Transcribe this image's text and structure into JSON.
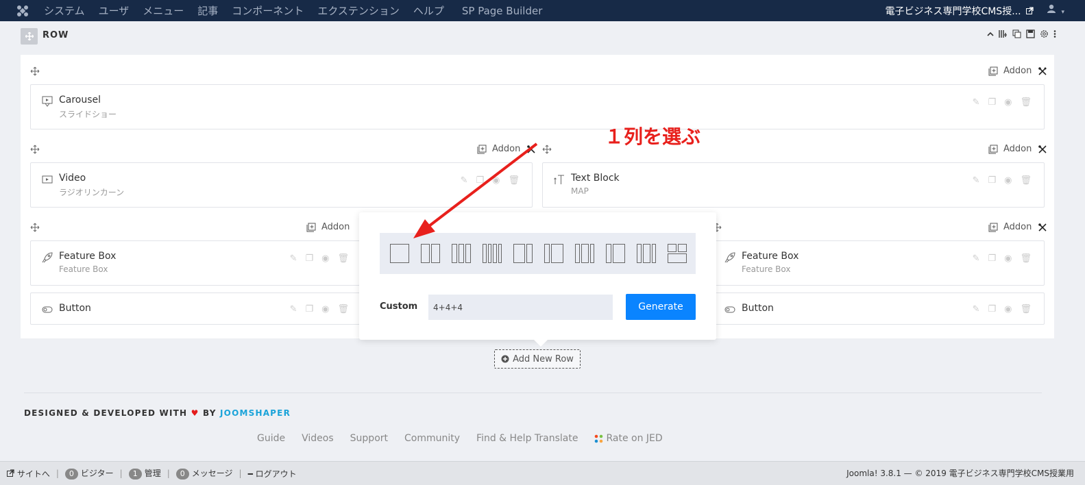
{
  "topbar": {
    "menu": [
      "システム",
      "ユーザ",
      "メニュー",
      "記事",
      "コンポーネント",
      "エクステンション",
      "ヘルプ"
    ],
    "page_builder": "SP Page Builder",
    "site_name": "電子ビジネス専門学校CMS授..."
  },
  "row": {
    "title": "ROW"
  },
  "addon_label": "Addon",
  "cards": {
    "carousel": {
      "title": "Carousel",
      "subtitle": "スライドショー"
    },
    "video": {
      "title": "Video",
      "subtitle": "ラジオリンカーン"
    },
    "text_block": {
      "title": "Text Block",
      "subtitle": "MAP"
    },
    "feature_box_left": {
      "title": "Feature Box",
      "subtitle": "Feature Box"
    },
    "button_left": {
      "title": "Button"
    },
    "feature_box_right": {
      "title": "Feature Box",
      "subtitle": "Feature Box"
    },
    "button_right": {
      "title": "Button"
    }
  },
  "popover": {
    "custom_label": "Custom",
    "custom_value": "4+4+4",
    "generate_label": "Generate"
  },
  "add_row_label": "Add New Row",
  "annotation": "１列を選ぶ",
  "footer": {
    "credit_prefix": "DESIGNED & DEVELOPED WITH",
    "credit_by": "BY",
    "credit_brand": "JOOMSHAPER",
    "links": [
      "Guide",
      "Videos",
      "Support",
      "Community",
      "Find & Help Translate",
      "Rate on JED"
    ]
  },
  "status": {
    "site": "サイトへ",
    "visitors_count": "0",
    "visitors": "ビジター",
    "admin_count": "1",
    "admin": "管理",
    "messages_count": "0",
    "messages": "メッセージ",
    "logout": "ログアウト",
    "version": "Joomla! 3.8.1 — © 2019 電子ビジネス専門学校CMS授業用"
  },
  "colors": {
    "topbar": "#172a47",
    "accent": "#0a84ff",
    "annotation": "#e8201c"
  }
}
